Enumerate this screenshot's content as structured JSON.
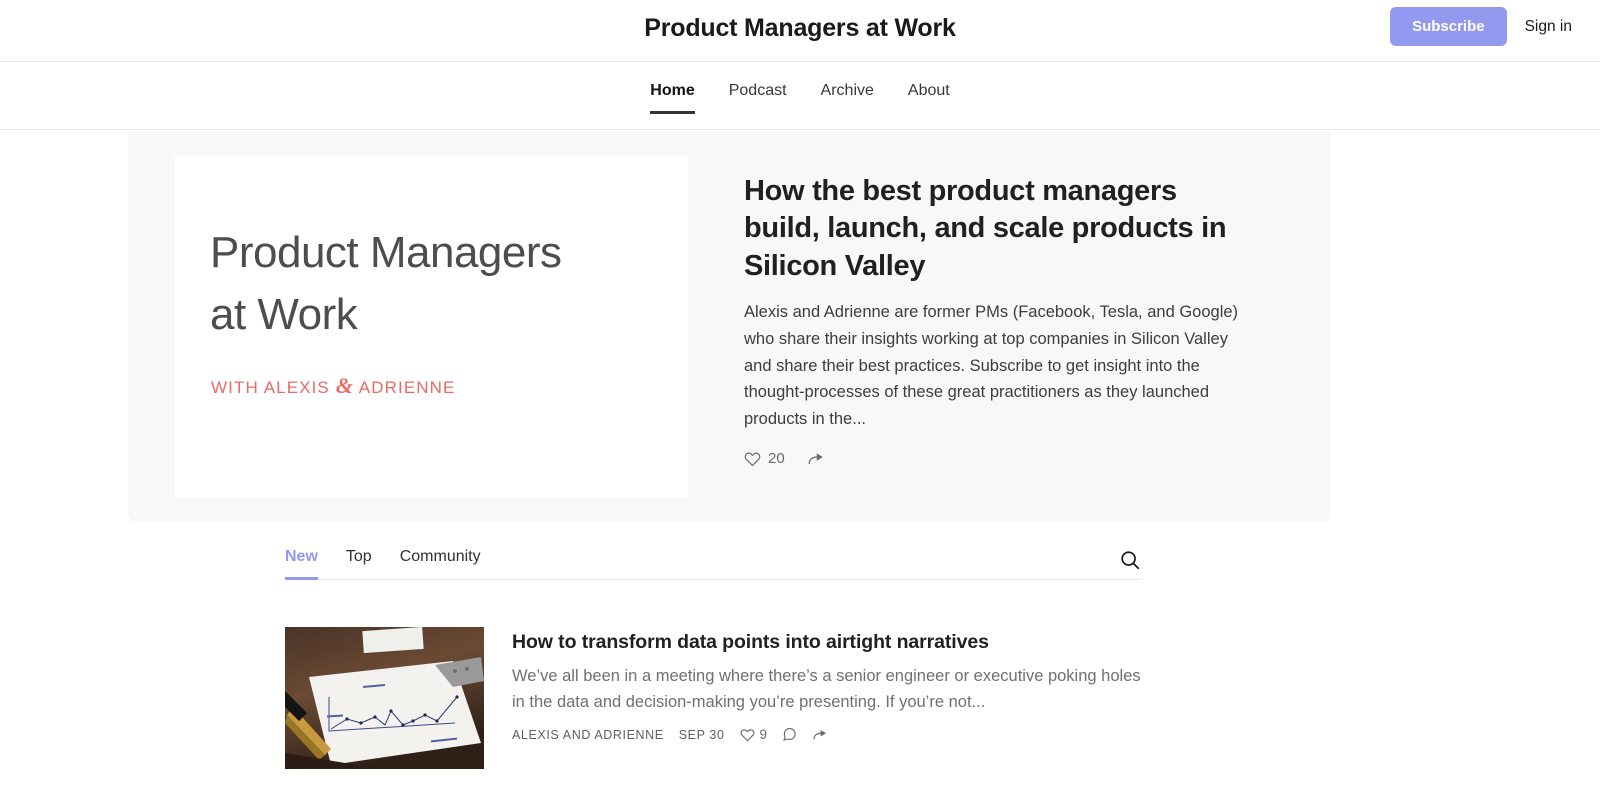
{
  "header": {
    "publication_title": "Product Managers at Work",
    "subscribe_label": "Subscribe",
    "signin_label": "Sign in",
    "subscribe_color": "#9299ee"
  },
  "nav": {
    "items": [
      {
        "label": "Home",
        "active": true
      },
      {
        "label": "Podcast",
        "active": false
      },
      {
        "label": "Archive",
        "active": false
      },
      {
        "label": "About",
        "active": false
      }
    ]
  },
  "hero": {
    "cover": {
      "title_line1": "Product Managers",
      "title_line2": "at Work",
      "byline_prefix": "WITH ALEXIS",
      "byline_amp": "&",
      "byline_suffix": "ADRIENNE",
      "byline_color": "#ea6a63",
      "title_color": "#4d4d4d"
    },
    "headline": "How the best product managers build, launch, and scale products in Silicon Valley",
    "description": "Alexis and Adrienne are former PMs (Facebook, Tesla, and Google) who share their insights working at top companies in Silicon Valley and share their best practices. Subscribe to get insight into the thought-processes of these great practitioners as they launched products in the...",
    "like_count": "20"
  },
  "feed": {
    "tabs": [
      {
        "label": "New",
        "active": true
      },
      {
        "label": "Top",
        "active": false
      },
      {
        "label": "Community",
        "active": false
      }
    ],
    "active_tab_color": "#9299ee",
    "search_icon": "search-icon",
    "posts": [
      {
        "title": "How to transform data points into airtight narratives",
        "subtitle": "We’ve all been in a meeting where there’s a senior engineer or executive poking holes in the data and decision-making you’re presenting. If you’re not...",
        "author": "ALEXIS AND ADRIENNE",
        "date": "SEP 30",
        "like_count": "9",
        "thumbnail_alt": "Hand-drawn line chart on white paper on a dark wooden desk with a gold pen and metal ruler"
      }
    ]
  }
}
